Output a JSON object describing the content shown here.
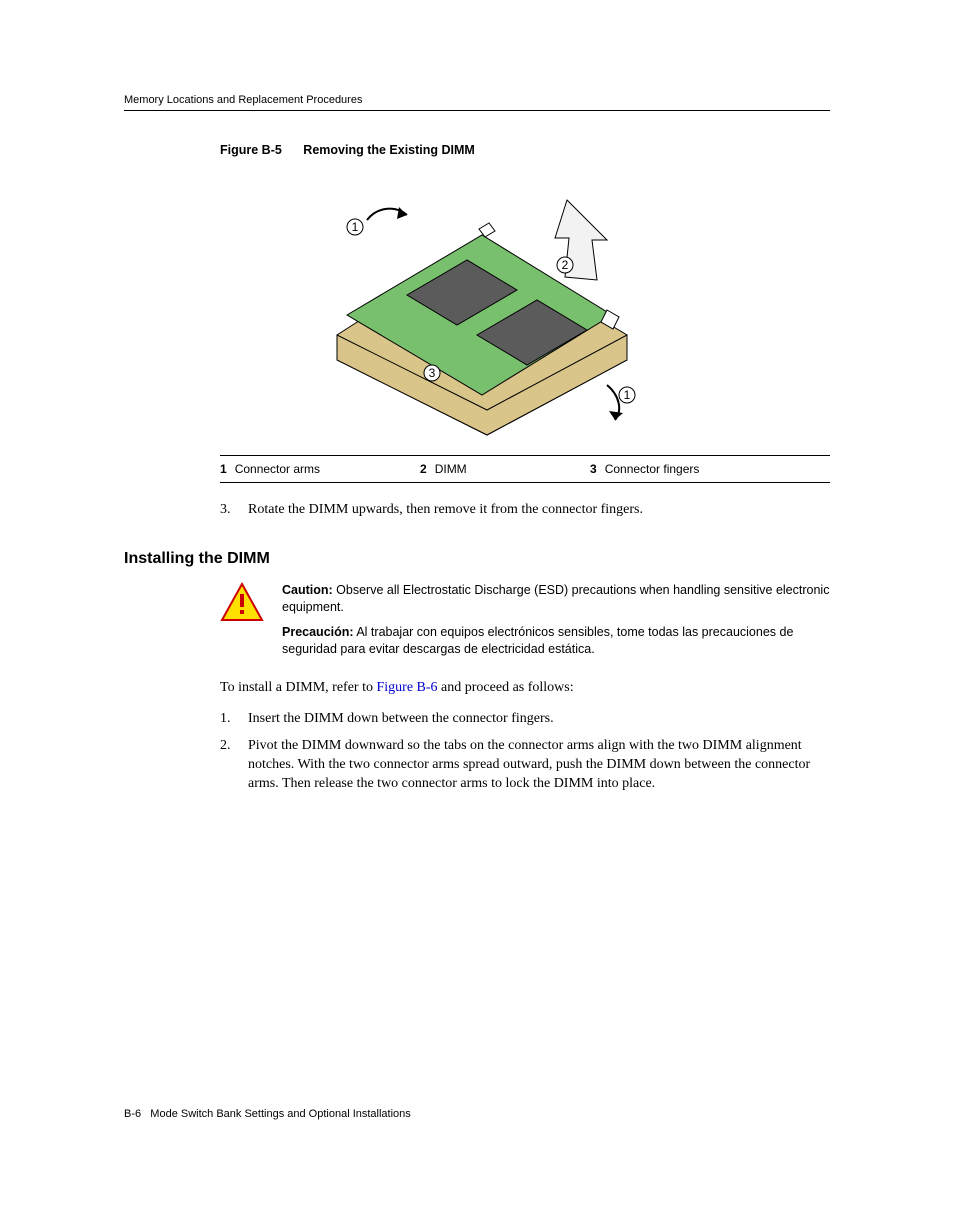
{
  "header": {
    "running_title": "Memory Locations and Replacement Procedures"
  },
  "figure": {
    "label": "Figure B-5",
    "title": "Removing the Existing DIMM",
    "callouts": {
      "c1": "1",
      "c2": "2",
      "c3": "3"
    }
  },
  "legend": {
    "n1": "1",
    "t1": "Connector arms",
    "n2": "2",
    "t2": "DIMM",
    "n3": "3",
    "t3": "Connector fingers"
  },
  "step3": {
    "num": "3.",
    "text": "Rotate the DIMM upwards, then remove it from the connector fingers."
  },
  "section_heading": "Installing the DIMM",
  "caution": {
    "caution_label": "Caution:",
    "caution_text": " Observe all Electrostatic Discharge (ESD) precautions when handling sensitive electronic equipment.",
    "precaucion_label": "Precaución:",
    "precaucion_text": " Al trabajar con equipos electrónicos sensibles, tome todas las precauciones de seguridad para evitar descargas de electricidad estática."
  },
  "install_intro": {
    "pre": "To install a DIMM, refer to ",
    "xref": "Figure B-6",
    "post": " and proceed as follows:"
  },
  "install_step1": {
    "num": "1.",
    "text": "Insert the DIMM down between the connector fingers."
  },
  "install_step2": {
    "num": "2.",
    "text": "Pivot the DIMM downward so the tabs on the connector arms align with the two DIMM alignment notches. With the two connector arms spread outward, push the DIMM down between the connector arms. Then release the two connector arms to lock the DIMM into place."
  },
  "footer": {
    "page_number": "B-6",
    "chapter": "Mode Switch Bank Settings and Optional Installations"
  }
}
